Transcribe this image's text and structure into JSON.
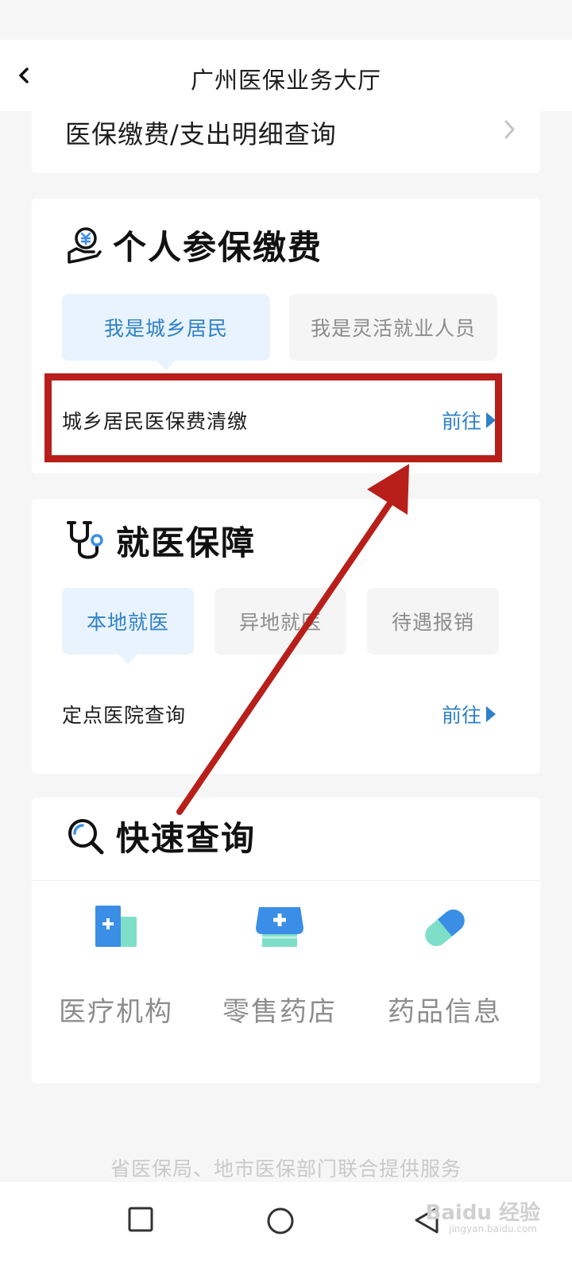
{
  "header": {
    "title": "广州医保业务大厅"
  },
  "query_card": {
    "label": "医保缴费/支出明细查询"
  },
  "personal_payment": {
    "title": "个人参保缴费",
    "tabs": [
      {
        "label": "我是城乡居民",
        "active": true
      },
      {
        "label": "我是灵活就业人员",
        "active": false
      }
    ],
    "row": {
      "label": "城乡居民医保费清缴",
      "action": "前往"
    }
  },
  "medical": {
    "title": "就医保障",
    "tabs": [
      {
        "label": "本地就医",
        "active": true
      },
      {
        "label": "异地就医",
        "active": false
      },
      {
        "label": "待遇报销",
        "active": false
      }
    ],
    "row": {
      "label": "定点医院查询",
      "action": "前往"
    }
  },
  "quick_query": {
    "title": "快速查询",
    "items": [
      {
        "label": "医疗机构",
        "icon": "medical-institution-icon"
      },
      {
        "label": "零售药店",
        "icon": "pharmacy-store-icon"
      },
      {
        "label": "药品信息",
        "icon": "capsule-icon"
      }
    ]
  },
  "footer": {
    "note": "省医保局、地市医保部门联合提供服务"
  },
  "watermark": {
    "brand": "Baidu 经验",
    "url": "jingyan.baidu.com"
  },
  "colors": {
    "accent": "#2f80c7",
    "highlight": "#b81f1a",
    "teal": "#7edfc8",
    "blue": "#3a8ee6"
  }
}
